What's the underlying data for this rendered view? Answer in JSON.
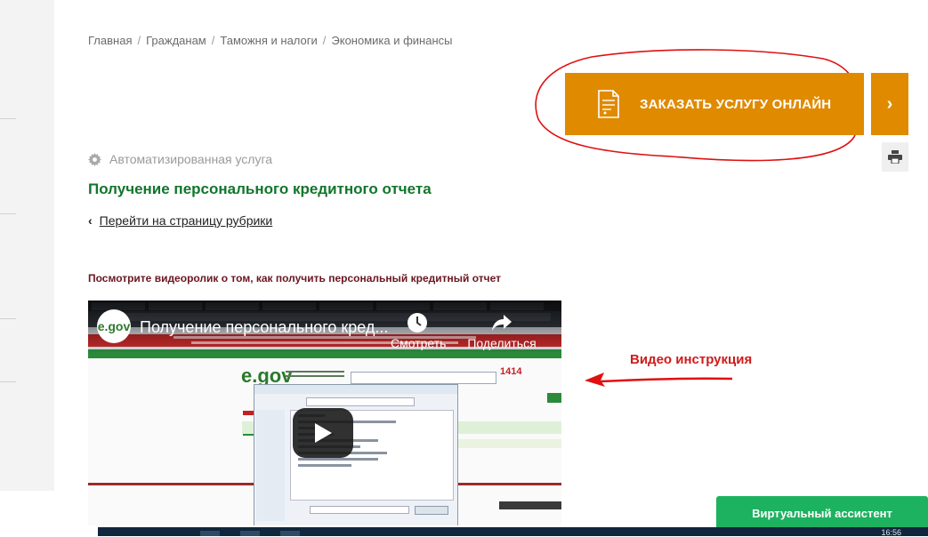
{
  "breadcrumb": {
    "items": [
      "Главная",
      "Гражданам",
      "Таможня и налоги",
      "Экономика и финансы"
    ],
    "separator": "/"
  },
  "order_button": {
    "label": "ЗАКАЗАТЬ УСЛУГУ ОНЛАЙН",
    "arrow": "›",
    "color": "#e08a00"
  },
  "service": {
    "type_label": "Автоматизированная услуга",
    "title": "Получение персонального кредитного отчета",
    "back_link": "Перейти на страницу рубрики",
    "title_color": "#12752c"
  },
  "video": {
    "caption": "Посмотрите видеоролик о том, как получить персональный кредитный отчет",
    "channel_logo": "e.gov",
    "title": "Получение персонального кред...",
    "watch_label": "Смотреть",
    "share_label": "Поделиться",
    "inner_site": {
      "logo": "e.gov",
      "phone": "1414"
    }
  },
  "annotation": {
    "label": "Видео инструкция",
    "color": "#d01a1a"
  },
  "assistant": {
    "label": "Виртуальный ассистент",
    "color": "#1db25f"
  },
  "taskbar": {
    "clock": "16:56"
  },
  "icons": {
    "order": "document-icon",
    "print": "printer-icon",
    "service": "gear-icon",
    "back": "chevron-left-icon",
    "play": "play-icon",
    "watch": "clock-icon",
    "share": "share-icon"
  }
}
